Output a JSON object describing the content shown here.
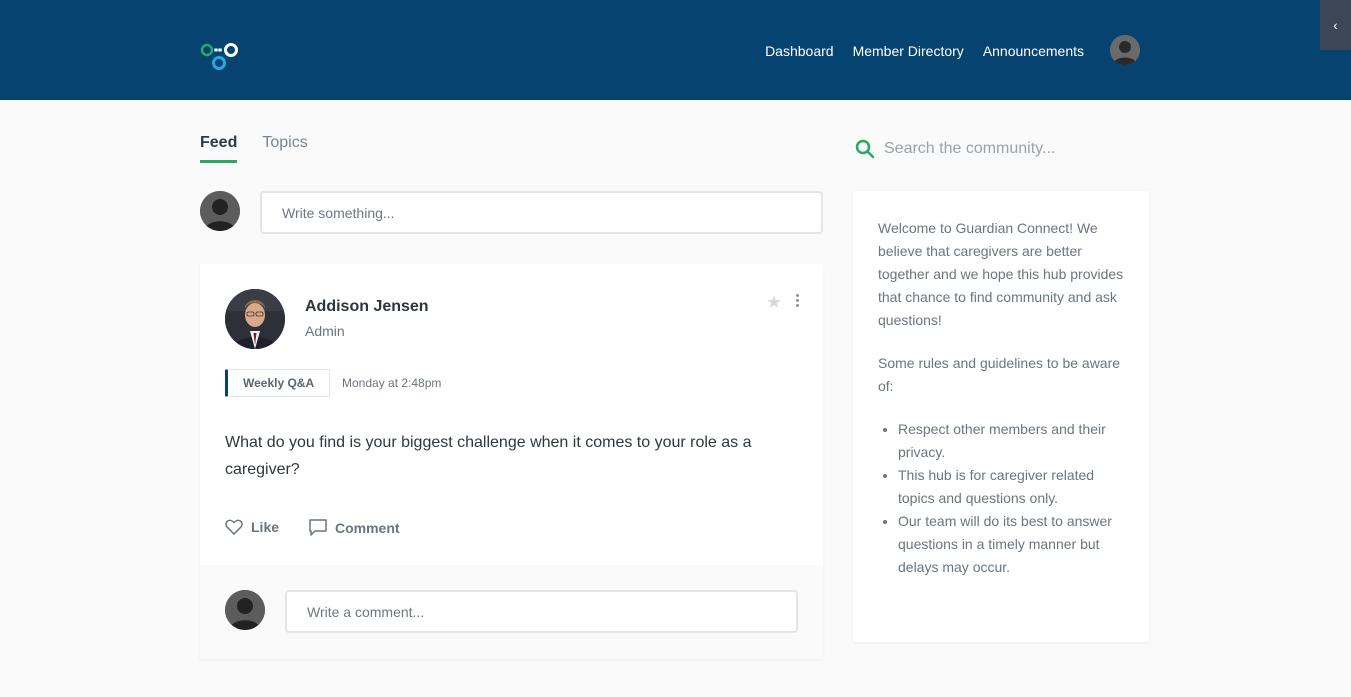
{
  "header": {
    "nav": [
      "Dashboard",
      "Member Directory",
      "Announcements"
    ],
    "collapse_icon": "chevron-left-icon"
  },
  "tabs": [
    "Feed",
    "Topics"
  ],
  "active_tab": "Feed",
  "search": {
    "placeholder": "Search the community..."
  },
  "composer": {
    "placeholder": "Write something..."
  },
  "post": {
    "author": "Addison Jensen",
    "role": "Admin",
    "tag": "Weekly Q&A",
    "timestamp": "Monday at 2:48pm",
    "body": "What do you find is your biggest challenge when it comes to your role as a caregiver?",
    "like_label": "Like",
    "comment_label": "Comment",
    "comment_placeholder": "Write a comment..."
  },
  "sidebar": {
    "intro": "Welcome to Guardian Connect! We believe that caregivers are better together and we hope this hub provides that chance to find community and ask questions!",
    "rules_heading": "Some rules and guidelines to be aware of:",
    "rules": [
      "Respect other members and their privacy.",
      "This hub is for caregiver related topics and questions only.",
      "Our team will do its best to answer questions in a timely manner but delays may occur."
    ]
  },
  "colors": {
    "header_bg": "#064370",
    "accent_green": "#2aa866",
    "tag_border": "#064370"
  }
}
